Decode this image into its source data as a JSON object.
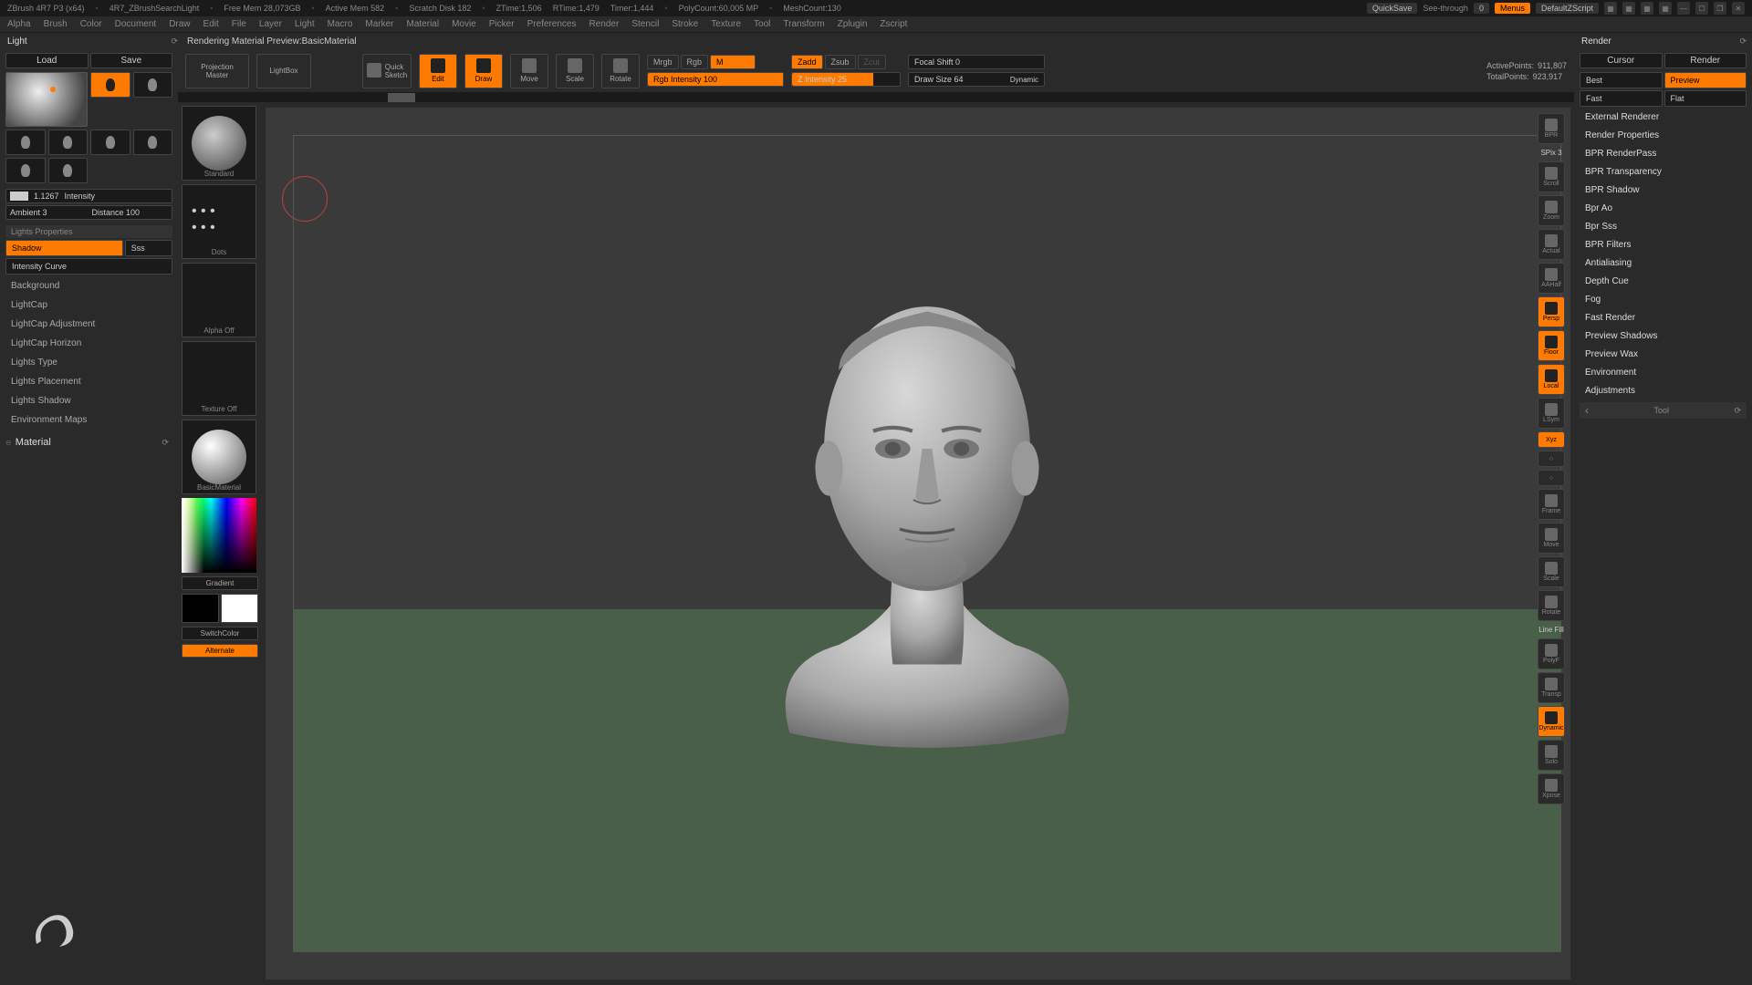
{
  "titlebar": {
    "app": "ZBrush 4R7 P3 (x64)",
    "file": "4R7_ZBrushSearchLight",
    "freemem": "Free Mem 28,073GB",
    "activemem": "Active Mem 582",
    "scratch": "Scratch Disk 182",
    "ztime": "ZTime:1,506",
    "rtime": "RTime:1,479",
    "timer": "Timer:1,444",
    "polycount": "PolyCount:60,005 MP",
    "meshcount": "MeshCount:130",
    "quicksave": "QuickSave",
    "seethrough": "See-through",
    "seethrough_val": "0",
    "menus": "Menus",
    "layout": "DefaultZScript"
  },
  "menus": [
    "Alpha",
    "Brush",
    "Color",
    "Document",
    "Draw",
    "Edit",
    "File",
    "Layer",
    "Light",
    "Macro",
    "Marker",
    "Material",
    "Movie",
    "Picker",
    "Preferences",
    "Render",
    "Stencil",
    "Stroke",
    "Texture",
    "Tool",
    "Transform",
    "Zplugin",
    "Zscript"
  ],
  "header": {
    "left": "Light",
    "status": "Rendering Material Preview:BasicMaterial",
    "right": "Render"
  },
  "left": {
    "load": "Load",
    "save": "Save",
    "intensity_val": "1.1267",
    "intensity_label": "Intensity",
    "ambient": "Ambient 3",
    "distance": "Distance 100",
    "props_header": "Lights Properties",
    "shadow": "Shadow",
    "sss": "Sss",
    "intensity_curve": "Intensity Curve",
    "items": [
      "Background",
      "LightCap",
      "LightCap Adjustment",
      "LightCap Horizon",
      "Lights Type",
      "Lights Placement",
      "Lights Shadow",
      "Environment Maps"
    ],
    "material_header": "Material"
  },
  "toolbar": {
    "projection": "Projection\nMaster",
    "lightbox": "LightBox",
    "quicksketch": "Quick\nSketch",
    "edit": "Edit",
    "draw": "Draw",
    "move": "Move",
    "scale": "Scale",
    "rotate": "Rotate",
    "mrgb": "Mrgb",
    "rgb": "Rgb",
    "m": "M",
    "zadd": "Zadd",
    "zsub": "Zsub",
    "zcut": "Zcut",
    "rgb_intensity": "Rgb Intensity 100",
    "z_intensity": "Z Intensity 25",
    "focal_shift": "Focal Shift 0",
    "draw_size": "Draw Size 64",
    "dynamic": "Dynamic",
    "activepoints_l": "ActivePoints:",
    "activepoints_v": "911,807",
    "totalpoints_l": "TotalPoints:",
    "totalpoints_v": "923,917"
  },
  "materials": {
    "standard": "Standard",
    "dots": "Dots",
    "alpha_off": "Alpha Off",
    "texture_off": "Texture Off",
    "basic": "BasicMaterial",
    "gradient": "Gradient",
    "switchcolor": "SwitchColor",
    "alternate": "Alternate"
  },
  "righttools": {
    "bpr": "BPR",
    "spix": "SPix 3",
    "scroll": "Scroll",
    "zoom": "Zoom",
    "actual": "Actual",
    "aahalf": "AAHalf",
    "persp": "Persp",
    "floor": "Floor",
    "local": "Local",
    "lsym": "LSym",
    "xyz": "Xyz",
    "frame": "Frame",
    "move": "Move",
    "scale": "Scale",
    "rotate": "Rotate",
    "linefill": "Line Fill",
    "polyf": "PolyF",
    "transp": "Transp",
    "dynamic": "Dynamic",
    "solo": "Solo",
    "xpose": "Xpose"
  },
  "right": {
    "cursor": "Cursor",
    "render": "Render",
    "best": "Best",
    "preview": "Preview",
    "fast": "Fast",
    "flat": "Flat",
    "items": [
      "External Renderer",
      "Render Properties",
      "BPR RenderPass",
      "BPR Transparency",
      "BPR Shadow",
      "Bpr Ao",
      "Bpr Sss",
      "BPR Filters",
      "Antialiasing",
      "Depth Cue",
      "Fog",
      "Fast Render",
      "Preview Shadows",
      "Preview Wax",
      "Environment",
      "Adjustments"
    ],
    "tool_header": "Tool"
  }
}
